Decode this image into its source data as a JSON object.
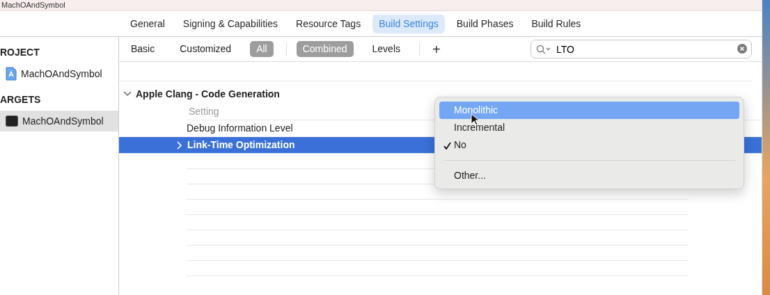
{
  "window": {
    "title": "MachOAndSymbol"
  },
  "tabs": [
    {
      "label": "General",
      "selected": false
    },
    {
      "label": "Signing & Capabilities",
      "selected": false
    },
    {
      "label": "Resource Tags",
      "selected": false
    },
    {
      "label": "Build Settings",
      "selected": true
    },
    {
      "label": "Build Phases",
      "selected": false
    },
    {
      "label": "Build Rules",
      "selected": false
    }
  ],
  "sidebar": {
    "sections": [
      {
        "title": "ROJECT",
        "items": [
          {
            "label": "MachOAndSymbol",
            "kind": "project",
            "selected": false
          }
        ]
      },
      {
        "title": "ARGETS",
        "items": [
          {
            "label": "MachOAndSymbol",
            "kind": "target",
            "selected": true
          }
        ]
      }
    ]
  },
  "filters": {
    "scope": [
      {
        "label": "Basic",
        "selected": false
      },
      {
        "label": "Customized",
        "selected": false
      },
      {
        "label": "All",
        "selected": true
      }
    ],
    "view": [
      {
        "label": "Combined",
        "selected": true
      },
      {
        "label": "Levels",
        "selected": false
      }
    ],
    "add_button": "+"
  },
  "search": {
    "value": "LTO"
  },
  "group": {
    "title": "Apple Clang - Code Generation",
    "expanded": true,
    "column": "Setting",
    "rows": [
      {
        "name": "Debug Information Level",
        "selected": false,
        "expandable": false
      },
      {
        "name": "Link-Time Optimization",
        "selected": true,
        "expandable": true
      }
    ]
  },
  "menu": {
    "items": [
      {
        "kind": "option",
        "label": "Monolithic",
        "highlighted": true,
        "checked": false
      },
      {
        "kind": "option",
        "label": "Incremental",
        "highlighted": false,
        "checked": false
      },
      {
        "kind": "option",
        "label": "No",
        "highlighted": false,
        "checked": true
      },
      {
        "kind": "separator"
      },
      {
        "kind": "option",
        "label": "Other...",
        "highlighted": false,
        "checked": false
      }
    ]
  }
}
